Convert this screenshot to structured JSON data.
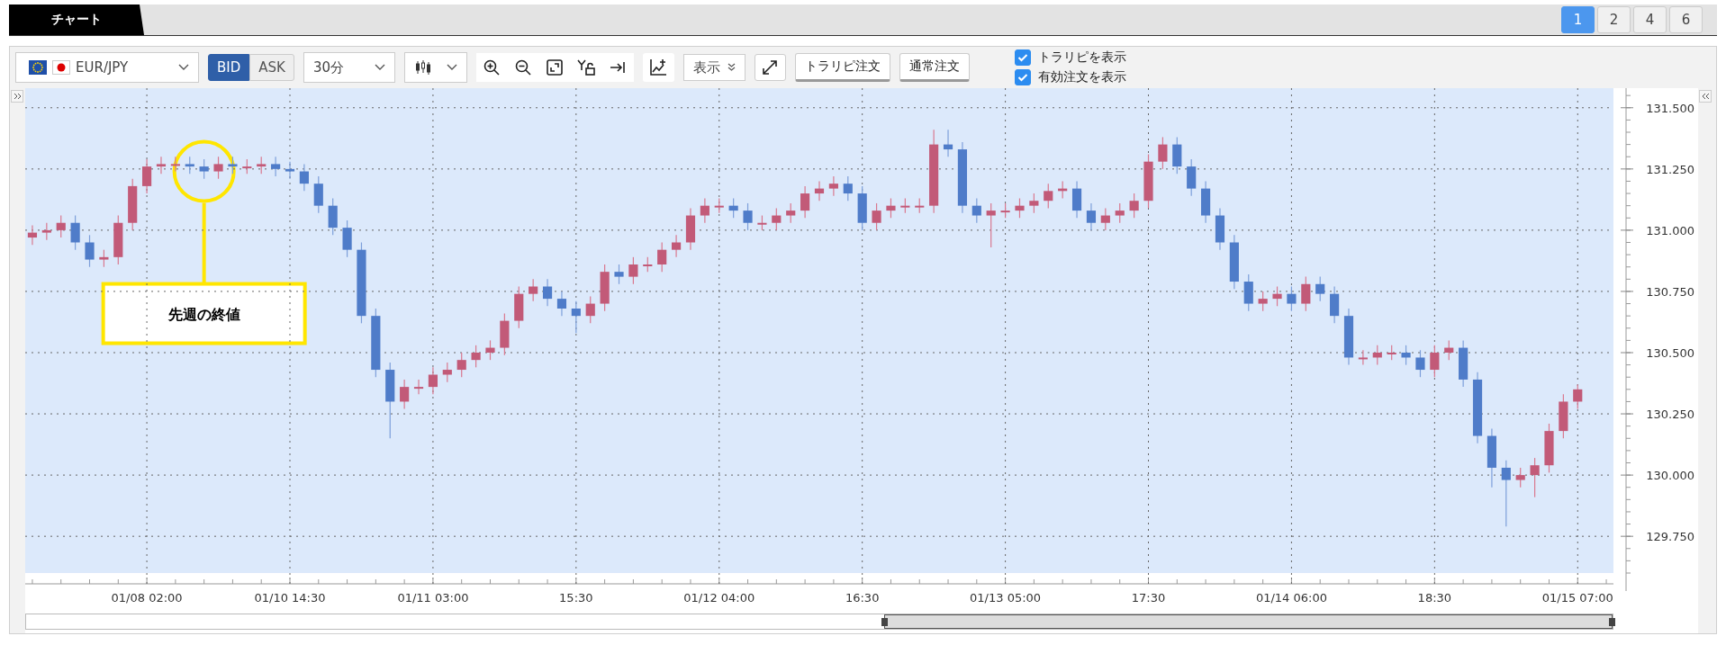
{
  "tab": {
    "label": "チャート",
    "selected": true
  },
  "layout_buttons": [
    {
      "label": "1",
      "selected": true
    },
    {
      "label": "2",
      "selected": false
    },
    {
      "label": "4",
      "selected": false
    },
    {
      "label": "6",
      "selected": false
    }
  ],
  "toolbar": {
    "symbol": "EUR/JPY",
    "price_side": [
      {
        "label": "BID",
        "selected": true
      },
      {
        "label": "ASK",
        "selected": false
      }
    ],
    "timeframe": "30分",
    "display_menu": "表示",
    "order_buttons": [
      "トラリピ注文",
      "通常注文"
    ],
    "options": [
      {
        "label": "トラリピを表示",
        "checked": true
      },
      {
        "label": "有効注文を表示",
        "checked": true
      }
    ]
  },
  "chart": {
    "chart_data": {
      "type": "candlestick",
      "categories": [
        null,
        null,
        null,
        null,
        null,
        null,
        null,
        null,
        "01/08 02:00",
        null,
        null,
        null,
        null,
        null,
        null,
        null,
        null,
        null,
        "01/10 14:30",
        null,
        null,
        null,
        null,
        null,
        null,
        null,
        null,
        null,
        "01/11 03:00",
        null,
        null,
        null,
        null,
        null,
        null,
        null,
        null,
        null,
        "15:30",
        null,
        null,
        null,
        null,
        null,
        null,
        null,
        null,
        null,
        "01/12 04:00",
        null,
        null,
        null,
        null,
        null,
        null,
        null,
        null,
        null,
        "16:30",
        null,
        null,
        null,
        null,
        null,
        null,
        null,
        null,
        null,
        "01/13 05:00",
        null,
        null,
        null,
        null,
        null,
        null,
        null,
        null,
        null,
        "17:30",
        null,
        null,
        null,
        null,
        null,
        null,
        null,
        null,
        null,
        "01/14 06:00",
        null,
        null,
        null,
        null,
        null,
        null,
        null,
        null,
        null,
        "18:30",
        null,
        null,
        null,
        null,
        null,
        null,
        null,
        null,
        null,
        "01/15 07:00"
      ],
      "ohlc": [
        [
          130.97,
          131.02,
          130.94,
          130.99
        ],
        [
          130.99,
          131.03,
          130.96,
          131.0
        ],
        [
          131.0,
          131.06,
          130.97,
          131.03
        ],
        [
          131.03,
          131.06,
          130.92,
          130.95
        ],
        [
          130.95,
          130.98,
          130.85,
          130.88
        ],
        [
          130.88,
          130.92,
          130.85,
          130.89
        ],
        [
          130.89,
          131.06,
          130.86,
          131.03
        ],
        [
          131.03,
          131.21,
          131.0,
          131.18
        ],
        [
          131.18,
          131.29,
          131.15,
          131.26
        ],
        [
          131.26,
          131.3,
          131.23,
          131.27
        ],
        [
          131.27,
          131.3,
          131.24,
          131.27
        ],
        [
          131.27,
          131.3,
          131.23,
          131.26
        ],
        [
          131.26,
          131.29,
          131.21,
          131.24
        ],
        [
          131.24,
          131.3,
          131.21,
          131.27
        ],
        [
          131.27,
          131.3,
          131.23,
          131.26
        ],
        [
          131.26,
          131.29,
          131.23,
          131.26
        ],
        [
          131.26,
          131.3,
          131.23,
          131.27
        ],
        [
          131.27,
          131.3,
          131.22,
          131.25
        ],
        [
          131.25,
          131.28,
          131.21,
          131.24
        ],
        [
          131.24,
          131.27,
          131.16,
          131.19
        ],
        [
          131.19,
          131.22,
          131.07,
          131.1
        ],
        [
          131.1,
          131.13,
          130.98,
          131.01
        ],
        [
          131.01,
          131.04,
          130.89,
          130.92
        ],
        [
          130.92,
          130.95,
          130.62,
          130.65
        ],
        [
          130.65,
          130.68,
          130.4,
          130.43
        ],
        [
          130.43,
          130.46,
          130.15,
          130.3
        ],
        [
          130.3,
          130.39,
          130.27,
          130.36
        ],
        [
          130.36,
          130.39,
          130.33,
          130.36
        ],
        [
          130.36,
          130.44,
          130.33,
          130.41
        ],
        [
          130.41,
          130.46,
          130.38,
          130.43
        ],
        [
          130.43,
          130.5,
          130.4,
          130.47
        ],
        [
          130.47,
          130.53,
          130.44,
          130.5
        ],
        [
          130.5,
          130.55,
          130.47,
          130.52
        ],
        [
          130.52,
          130.66,
          130.49,
          130.63
        ],
        [
          130.63,
          130.77,
          130.6,
          130.74
        ],
        [
          130.74,
          130.8,
          130.71,
          130.77
        ],
        [
          130.77,
          130.8,
          130.69,
          130.72
        ],
        [
          130.72,
          130.75,
          130.65,
          130.68
        ],
        [
          130.68,
          130.71,
          130.58,
          130.65
        ],
        [
          130.65,
          130.73,
          130.62,
          130.7
        ],
        [
          130.7,
          130.86,
          130.67,
          130.83
        ],
        [
          130.83,
          130.86,
          130.78,
          130.81
        ],
        [
          130.81,
          130.89,
          130.78,
          130.86
        ],
        [
          130.86,
          130.89,
          130.83,
          130.86
        ],
        [
          130.86,
          130.95,
          130.83,
          130.92
        ],
        [
          130.92,
          130.98,
          130.89,
          130.95
        ],
        [
          130.95,
          131.09,
          130.92,
          131.06
        ],
        [
          131.06,
          131.13,
          131.03,
          131.1
        ],
        [
          131.1,
          131.13,
          131.07,
          131.1
        ],
        [
          131.1,
          131.13,
          131.05,
          131.08
        ],
        [
          131.08,
          131.11,
          131.0,
          131.03
        ],
        [
          131.03,
          131.06,
          131.0,
          131.03
        ],
        [
          131.03,
          131.09,
          131.0,
          131.06
        ],
        [
          131.06,
          131.11,
          131.03,
          131.08
        ],
        [
          131.08,
          131.18,
          131.05,
          131.15
        ],
        [
          131.15,
          131.2,
          131.12,
          131.17
        ],
        [
          131.17,
          131.22,
          131.14,
          131.19
        ],
        [
          131.19,
          131.22,
          131.12,
          131.15
        ],
        [
          131.15,
          131.18,
          131.0,
          131.03
        ],
        [
          131.03,
          131.11,
          131.0,
          131.08
        ],
        [
          131.08,
          131.13,
          131.05,
          131.1
        ],
        [
          131.1,
          131.13,
          131.07,
          131.1
        ],
        [
          131.1,
          131.13,
          131.07,
          131.1
        ],
        [
          131.1,
          131.41,
          131.07,
          131.35
        ],
        [
          131.35,
          131.41,
          131.3,
          131.33
        ],
        [
          131.33,
          131.36,
          131.07,
          131.1
        ],
        [
          131.1,
          131.13,
          131.03,
          131.06
        ],
        [
          131.06,
          131.11,
          130.93,
          131.08
        ],
        [
          131.08,
          131.11,
          131.05,
          131.08
        ],
        [
          131.08,
          131.13,
          131.05,
          131.1
        ],
        [
          131.1,
          131.15,
          131.07,
          131.12
        ],
        [
          131.12,
          131.19,
          131.09,
          131.16
        ],
        [
          131.16,
          131.2,
          131.13,
          131.17
        ],
        [
          131.17,
          131.2,
          131.05,
          131.08
        ],
        [
          131.08,
          131.11,
          131.0,
          131.03
        ],
        [
          131.03,
          131.09,
          131.0,
          131.06
        ],
        [
          131.06,
          131.11,
          131.03,
          131.08
        ],
        [
          131.08,
          131.15,
          131.05,
          131.12
        ],
        [
          131.12,
          131.31,
          131.09,
          131.28
        ],
        [
          131.28,
          131.38,
          131.25,
          131.35
        ],
        [
          131.35,
          131.38,
          131.23,
          131.26
        ],
        [
          131.26,
          131.29,
          131.14,
          131.17
        ],
        [
          131.17,
          131.2,
          131.03,
          131.06
        ],
        [
          131.06,
          131.09,
          130.92,
          130.95
        ],
        [
          130.95,
          130.98,
          130.76,
          130.79
        ],
        [
          130.79,
          130.82,
          130.67,
          130.7
        ],
        [
          130.7,
          130.75,
          130.67,
          130.72
        ],
        [
          130.72,
          130.77,
          130.69,
          130.74
        ],
        [
          130.74,
          130.77,
          130.67,
          130.7
        ],
        [
          130.7,
          130.81,
          130.67,
          130.78
        ],
        [
          130.78,
          130.81,
          130.71,
          130.74
        ],
        [
          130.74,
          130.77,
          130.62,
          130.65
        ],
        [
          130.65,
          130.68,
          130.45,
          130.48
        ],
        [
          130.48,
          130.51,
          130.45,
          130.48
        ],
        [
          130.48,
          130.53,
          130.45,
          130.5
        ],
        [
          130.5,
          130.53,
          130.47,
          130.5
        ],
        [
          130.5,
          130.53,
          130.45,
          130.48
        ],
        [
          130.48,
          130.51,
          130.4,
          130.43
        ],
        [
          130.43,
          130.53,
          130.4,
          130.5
        ],
        [
          130.5,
          130.55,
          130.47,
          130.52
        ],
        [
          130.52,
          130.55,
          130.36,
          130.39
        ],
        [
          130.39,
          130.42,
          130.13,
          130.16
        ],
        [
          130.16,
          130.19,
          129.95,
          130.03
        ],
        [
          130.03,
          130.06,
          129.79,
          129.98
        ],
        [
          129.98,
          130.03,
          129.95,
          130.0
        ],
        [
          130.0,
          130.07,
          129.91,
          130.04
        ],
        [
          130.04,
          130.21,
          130.01,
          130.18
        ],
        [
          130.18,
          130.33,
          130.15,
          130.3
        ],
        [
          130.3,
          130.37,
          130.27,
          130.35
        ]
      ],
      "ylim": [
        129.6,
        131.58
      ],
      "yticks": [
        {
          "value": 129.75,
          "label": "129.750"
        },
        {
          "value": 130.0,
          "label": "130.000"
        },
        {
          "value": 130.25,
          "label": "130.250"
        },
        {
          "value": 130.5,
          "label": "130.500"
        },
        {
          "value": 130.75,
          "label": "130.750"
        },
        {
          "value": 131.0,
          "label": "131.000"
        },
        {
          "value": 131.25,
          "label": "131.250"
        },
        {
          "value": 131.5,
          "label": "131.500"
        }
      ],
      "grid": true,
      "annotations": [
        "先週の終値"
      ]
    }
  }
}
